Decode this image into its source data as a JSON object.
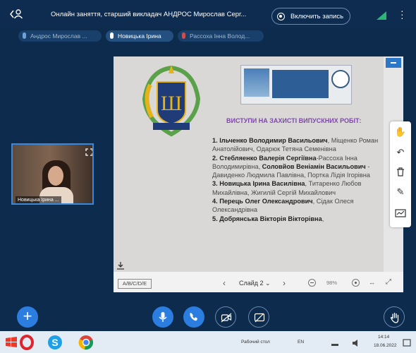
{
  "header": {
    "title": "Онлайн заняття, старший викладач АНДРОС Мирослав Серг...",
    "record_label": "Включить запись"
  },
  "participants": [
    {
      "name": "Андрос Мирослав ..."
    },
    {
      "name": "Новицька Ірина"
    },
    {
      "name": "Рассоха Інна Волод..."
    }
  ],
  "camera": {
    "name": "Новицька Ірина ..."
  },
  "slide": {
    "heading": "ВИСТУПИ НА ЗАХИСТІ ВИПУСКНИХ РОБІТ:",
    "items": [
      {
        "bold": "1. Ільченко Володимир Васильович",
        "rest": ", Міщенко Роман Анатолійович, Одарюк Тетяна Семенівна"
      },
      {
        "bold": "2. Стебляенко Валерія Сергіївна",
        "rest": "-Рассоха Інна Володимирівна, ",
        "bold2": "Соловйов Веніамін Васильович",
        "rest2": " - Давиденко Людмила Павлівна, Портка Лідія Ігорівна"
      },
      {
        "bold": "3. Новицька Ірина Василівна",
        "rest": ", Титаренко Любов Михайлівна, Жигилій Сергій Михайлович"
      },
      {
        "bold": "4. Перець Олег Олександрович",
        "rest": ", Сідак Олеся Олександрівна"
      },
      {
        "bold": "5. Добрянська Вікторія Вікторівна",
        "rest": ","
      }
    ]
  },
  "toolbar": {
    "layout_label": "A/B/C/D/E",
    "slide_label": "Слайд 2",
    "zoom": "98%"
  },
  "taskbar": {
    "desktop_label": "Рабочий стол",
    "lang": "EN",
    "time": "14:14",
    "date": "18.06.2022"
  },
  "colors": {
    "accent": "#2b7de0",
    "background": "#0d2b4d",
    "heading": "#7d47a8"
  }
}
